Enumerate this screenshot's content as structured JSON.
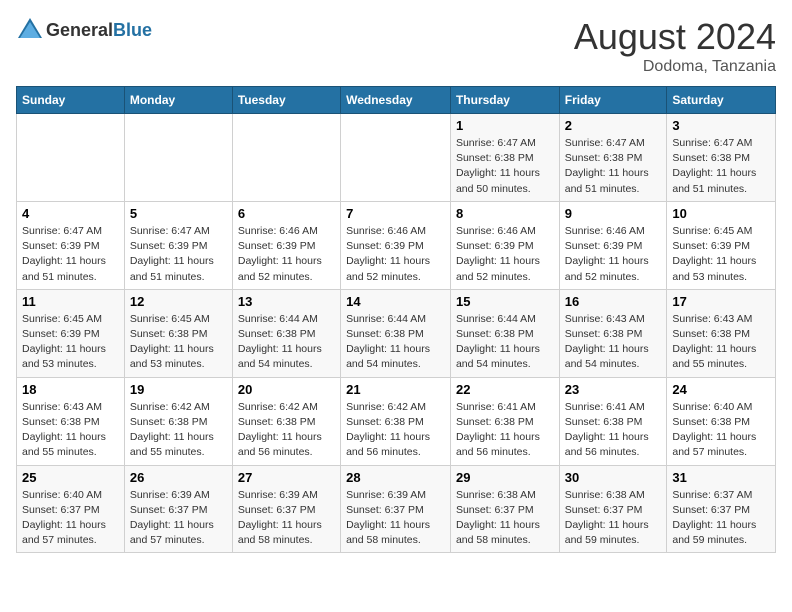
{
  "header": {
    "logo_general": "General",
    "logo_blue": "Blue",
    "title": "August 2024",
    "location": "Dodoma, Tanzania"
  },
  "days_of_week": [
    "Sunday",
    "Monday",
    "Tuesday",
    "Wednesday",
    "Thursday",
    "Friday",
    "Saturday"
  ],
  "weeks": [
    [
      {
        "day": "",
        "info": ""
      },
      {
        "day": "",
        "info": ""
      },
      {
        "day": "",
        "info": ""
      },
      {
        "day": "",
        "info": ""
      },
      {
        "day": "1",
        "info": "Sunrise: 6:47 AM\nSunset: 6:38 PM\nDaylight: 11 hours\nand 50 minutes."
      },
      {
        "day": "2",
        "info": "Sunrise: 6:47 AM\nSunset: 6:38 PM\nDaylight: 11 hours\nand 51 minutes."
      },
      {
        "day": "3",
        "info": "Sunrise: 6:47 AM\nSunset: 6:38 PM\nDaylight: 11 hours\nand 51 minutes."
      }
    ],
    [
      {
        "day": "4",
        "info": "Sunrise: 6:47 AM\nSunset: 6:39 PM\nDaylight: 11 hours\nand 51 minutes."
      },
      {
        "day": "5",
        "info": "Sunrise: 6:47 AM\nSunset: 6:39 PM\nDaylight: 11 hours\nand 51 minutes."
      },
      {
        "day": "6",
        "info": "Sunrise: 6:46 AM\nSunset: 6:39 PM\nDaylight: 11 hours\nand 52 minutes."
      },
      {
        "day": "7",
        "info": "Sunrise: 6:46 AM\nSunset: 6:39 PM\nDaylight: 11 hours\nand 52 minutes."
      },
      {
        "day": "8",
        "info": "Sunrise: 6:46 AM\nSunset: 6:39 PM\nDaylight: 11 hours\nand 52 minutes."
      },
      {
        "day": "9",
        "info": "Sunrise: 6:46 AM\nSunset: 6:39 PM\nDaylight: 11 hours\nand 52 minutes."
      },
      {
        "day": "10",
        "info": "Sunrise: 6:45 AM\nSunset: 6:39 PM\nDaylight: 11 hours\nand 53 minutes."
      }
    ],
    [
      {
        "day": "11",
        "info": "Sunrise: 6:45 AM\nSunset: 6:39 PM\nDaylight: 11 hours\nand 53 minutes."
      },
      {
        "day": "12",
        "info": "Sunrise: 6:45 AM\nSunset: 6:38 PM\nDaylight: 11 hours\nand 53 minutes."
      },
      {
        "day": "13",
        "info": "Sunrise: 6:44 AM\nSunset: 6:38 PM\nDaylight: 11 hours\nand 54 minutes."
      },
      {
        "day": "14",
        "info": "Sunrise: 6:44 AM\nSunset: 6:38 PM\nDaylight: 11 hours\nand 54 minutes."
      },
      {
        "day": "15",
        "info": "Sunrise: 6:44 AM\nSunset: 6:38 PM\nDaylight: 11 hours\nand 54 minutes."
      },
      {
        "day": "16",
        "info": "Sunrise: 6:43 AM\nSunset: 6:38 PM\nDaylight: 11 hours\nand 54 minutes."
      },
      {
        "day": "17",
        "info": "Sunrise: 6:43 AM\nSunset: 6:38 PM\nDaylight: 11 hours\nand 55 minutes."
      }
    ],
    [
      {
        "day": "18",
        "info": "Sunrise: 6:43 AM\nSunset: 6:38 PM\nDaylight: 11 hours\nand 55 minutes."
      },
      {
        "day": "19",
        "info": "Sunrise: 6:42 AM\nSunset: 6:38 PM\nDaylight: 11 hours\nand 55 minutes."
      },
      {
        "day": "20",
        "info": "Sunrise: 6:42 AM\nSunset: 6:38 PM\nDaylight: 11 hours\nand 56 minutes."
      },
      {
        "day": "21",
        "info": "Sunrise: 6:42 AM\nSunset: 6:38 PM\nDaylight: 11 hours\nand 56 minutes."
      },
      {
        "day": "22",
        "info": "Sunrise: 6:41 AM\nSunset: 6:38 PM\nDaylight: 11 hours\nand 56 minutes."
      },
      {
        "day": "23",
        "info": "Sunrise: 6:41 AM\nSunset: 6:38 PM\nDaylight: 11 hours\nand 56 minutes."
      },
      {
        "day": "24",
        "info": "Sunrise: 6:40 AM\nSunset: 6:38 PM\nDaylight: 11 hours\nand 57 minutes."
      }
    ],
    [
      {
        "day": "25",
        "info": "Sunrise: 6:40 AM\nSunset: 6:37 PM\nDaylight: 11 hours\nand 57 minutes."
      },
      {
        "day": "26",
        "info": "Sunrise: 6:39 AM\nSunset: 6:37 PM\nDaylight: 11 hours\nand 57 minutes."
      },
      {
        "day": "27",
        "info": "Sunrise: 6:39 AM\nSunset: 6:37 PM\nDaylight: 11 hours\nand 58 minutes."
      },
      {
        "day": "28",
        "info": "Sunrise: 6:39 AM\nSunset: 6:37 PM\nDaylight: 11 hours\nand 58 minutes."
      },
      {
        "day": "29",
        "info": "Sunrise: 6:38 AM\nSunset: 6:37 PM\nDaylight: 11 hours\nand 58 minutes."
      },
      {
        "day": "30",
        "info": "Sunrise: 6:38 AM\nSunset: 6:37 PM\nDaylight: 11 hours\nand 59 minutes."
      },
      {
        "day": "31",
        "info": "Sunrise: 6:37 AM\nSunset: 6:37 PM\nDaylight: 11 hours\nand 59 minutes."
      }
    ]
  ]
}
